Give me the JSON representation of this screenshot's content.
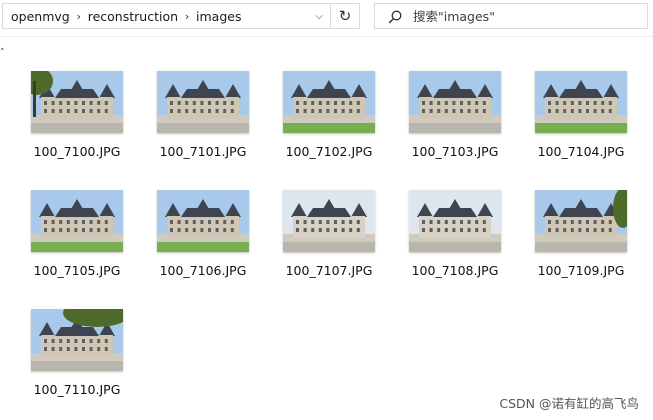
{
  "breadcrumb": [
    "openmvg",
    "reconstruction",
    "images"
  ],
  "search": {
    "placeholder": "搜索\"images\""
  },
  "files": [
    {
      "name": "100_7100.JPG",
      "variant": "tree-left"
    },
    {
      "name": "100_7101.JPG",
      "variant": "front"
    },
    {
      "name": "100_7102.JPG",
      "variant": "front-lawn"
    },
    {
      "name": "100_7103.JPG",
      "variant": "front"
    },
    {
      "name": "100_7104.JPG",
      "variant": "front-lawn"
    },
    {
      "name": "100_7105.JPG",
      "variant": "front-lawn"
    },
    {
      "name": "100_7106.JPG",
      "variant": "front-lawn"
    },
    {
      "name": "100_7107.JPG",
      "variant": "pale"
    },
    {
      "name": "100_7108.JPG",
      "variant": "pale"
    },
    {
      "name": "100_7109.JPG",
      "variant": "tree-right"
    },
    {
      "name": "100_7110.JPG",
      "variant": "tree-top"
    }
  ],
  "watermark": "CSDN @诺有缸的高飞鸟",
  "colors": {
    "sky": "#a9c9ea",
    "stone": "#cfc6b3",
    "roof": "#3f4451",
    "lawn": "#79ad52",
    "tree": "#4e6b2c"
  }
}
